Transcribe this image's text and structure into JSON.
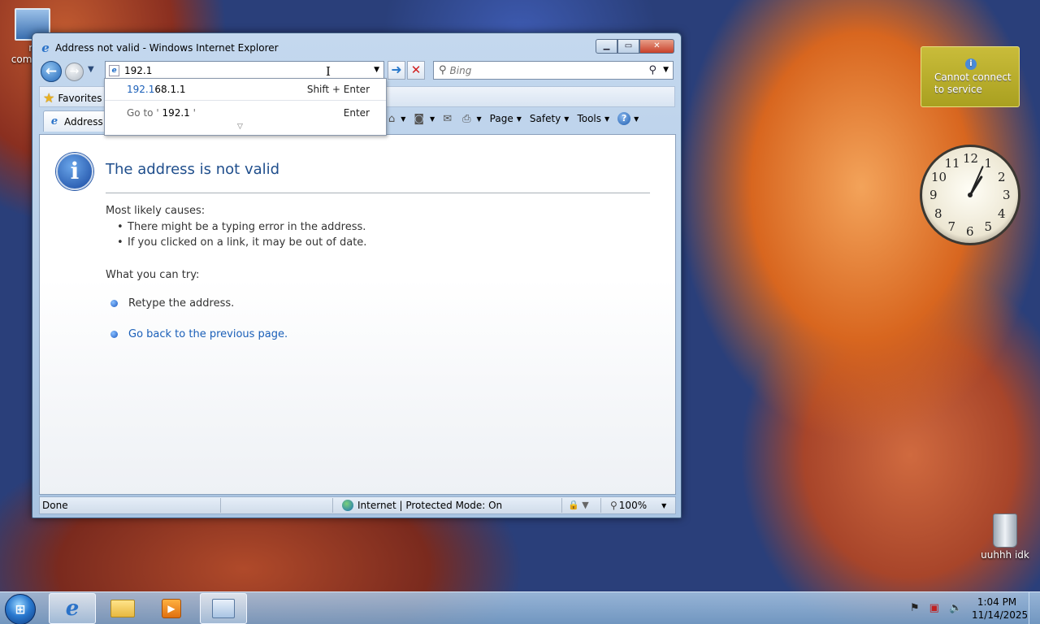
{
  "desktop": {
    "computer_icon_label": "m\ncomp",
    "recycle_bin_label": "uuhhh idk"
  },
  "weather_gadget": {
    "message": "Cannot connect to service"
  },
  "clock_gadget": {
    "numbers": [
      "12",
      "1",
      "2",
      "3",
      "4",
      "5",
      "6",
      "7",
      "8",
      "9",
      "10",
      "11"
    ],
    "hour": 1,
    "minute": 4
  },
  "window": {
    "title": "Address not valid - Windows Internet Explorer",
    "address": {
      "value": "192.1"
    },
    "search": {
      "placeholder": "Bing"
    },
    "favorites_label": "Favorites",
    "tab_title": "Address not valid",
    "command_bar": {
      "page": "Page",
      "safety": "Safety",
      "tools": "Tools"
    },
    "autocomplete": {
      "item1_highlight": "192.1",
      "item1_rest": "68.1.1",
      "item1_shortcut": "Shift + Enter",
      "item2_prefix": "Go to '",
      "item2_value": " 192.1 ",
      "item2_suffix": "'",
      "item2_shortcut": "Enter"
    },
    "error_page": {
      "title": "The address is not valid",
      "causes_heading": "Most likely causes:",
      "causes": [
        "There might be a typing error in the address.",
        "If you clicked on a link, it may be out of date."
      ],
      "try_heading": "What you can try:",
      "try_items": [
        {
          "label": "Retype the address.",
          "link": false
        },
        {
          "label": "Go back to the previous page.",
          "link": true
        }
      ]
    },
    "status": {
      "left": "Done",
      "zone": "Internet | Protected Mode: On",
      "zoom": "100%"
    }
  },
  "taskbar": {
    "time": "1:04 PM",
    "date": "11/14/2025"
  }
}
